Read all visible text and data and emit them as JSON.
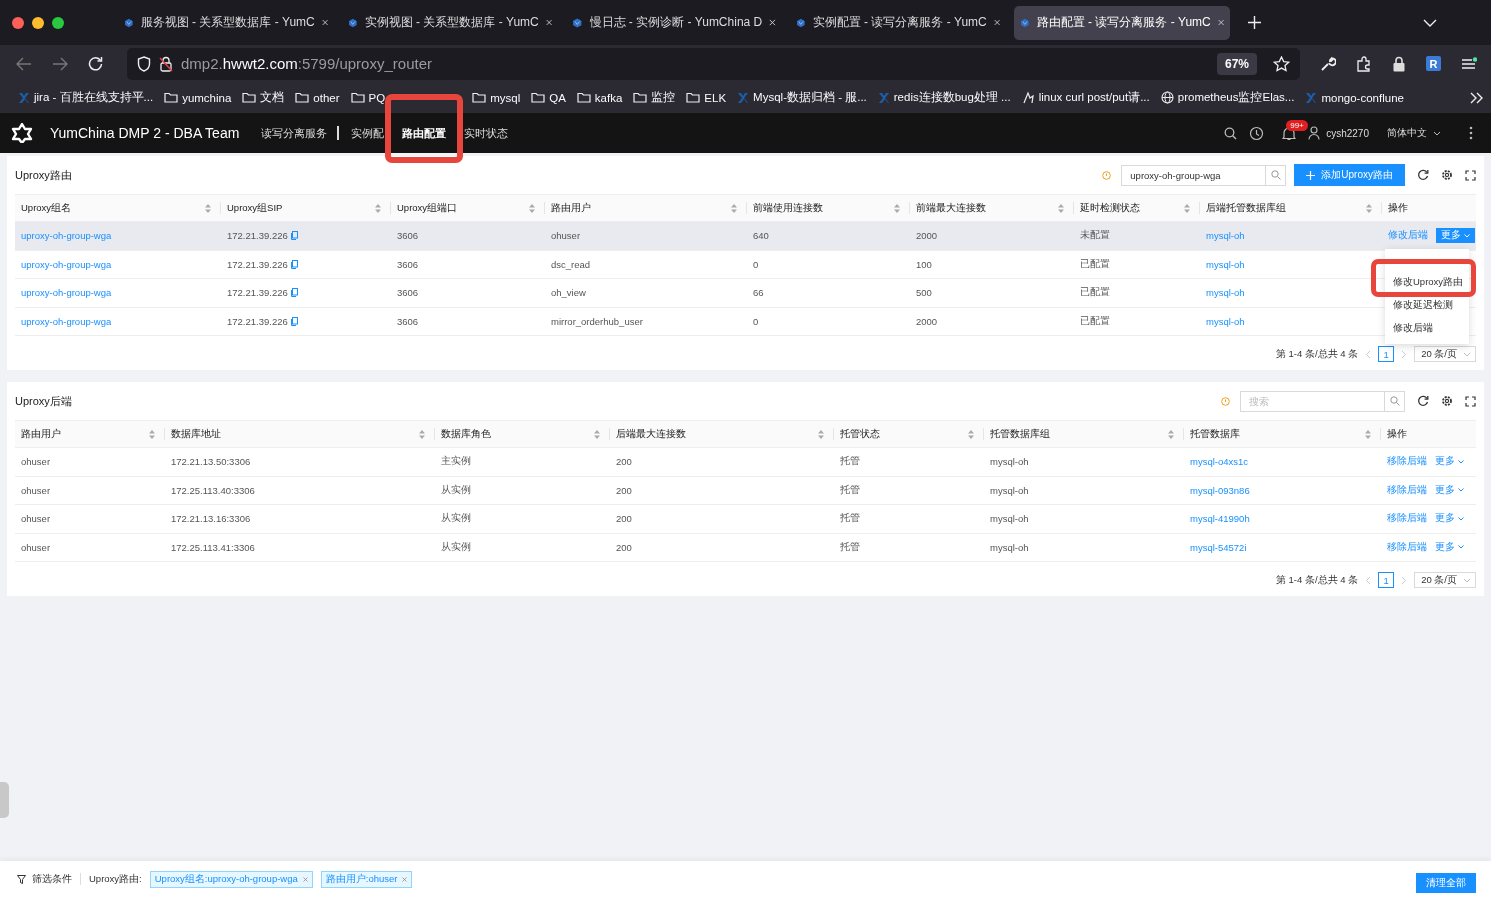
{
  "browser": {
    "tabs": [
      {
        "title": "服务视图 - 关系型数据库 - YumC",
        "selected": false
      },
      {
        "title": "实例视图 - 关系型数据库 - YumC",
        "selected": false
      },
      {
        "title": "慢日志 - 实例诊断 - YumChina D",
        "selected": false
      },
      {
        "title": "实例配置 - 读写分离服务 - YumC",
        "selected": false
      },
      {
        "title": "路由配置 - 读写分离服务 - YumC",
        "selected": true
      }
    ],
    "url": "dmp2.**hwwt2.com**:5799/uproxy_router",
    "zoom": "67%",
    "extension_label": "R"
  },
  "bookmarks": [
    {
      "kind": "app",
      "label": "jira - 百胜在线支持平..."
    },
    {
      "kind": "folder",
      "label": "yumchina"
    },
    {
      "kind": "folder",
      "label": "文档"
    },
    {
      "kind": "folder",
      "label": "other"
    },
    {
      "kind": "folder",
      "label": "PQ"
    },
    {
      "kind": "folder",
      "label": "mysql"
    },
    {
      "kind": "folder",
      "label": "QA"
    },
    {
      "kind": "folder",
      "label": "kafka"
    },
    {
      "kind": "folder",
      "label": "监控"
    },
    {
      "kind": "folder",
      "label": "ELK"
    },
    {
      "kind": "app",
      "label": "Mysql-数据归档 - 服..."
    },
    {
      "kind": "app",
      "label": "redis连接数bug处理 ..."
    },
    {
      "kind": "curl",
      "label": "linux curl post/put请..."
    },
    {
      "kind": "globe",
      "label": "prometheus监控Elas..."
    },
    {
      "kind": "app",
      "label": "mongo-conflune"
    }
  ],
  "app": {
    "title": "YumChina DMP 2 - DBA Team",
    "nav": [
      {
        "label": "读写分离服务",
        "selected": false
      },
      {
        "label": "实例配",
        "selected": false
      },
      {
        "label": "路由配置",
        "selected": true
      },
      {
        "label": "实时状态",
        "selected": false
      }
    ],
    "notification_badge": "99+",
    "user": "cysh2270",
    "language": "简体中文"
  },
  "router_panel": {
    "title": "Uproxy路由",
    "search_value": "uproxy-oh-group-wga",
    "add_button": "添加Uproxy路由",
    "columns": [
      "Uproxy组名",
      "Uproxy组SIP",
      "Uproxy组端口",
      "路由用户",
      "前端使用连接数",
      "前端最大连接数",
      "延时检测状态",
      "后端托管数据库组",
      "操作"
    ],
    "rows": [
      {
        "selected": true,
        "cells": [
          "uproxy-oh-group-wga",
          "172.21.39.226",
          "3606",
          "ohuser",
          "640",
          "2000",
          "未配置",
          "mysql-oh"
        ],
        "actions": [
          "修改后端",
          "更多"
        ]
      },
      {
        "selected": false,
        "cells": [
          "uproxy-oh-group-wga",
          "172.21.39.226",
          "3606",
          "dsc_read",
          "0",
          "100",
          "已配置",
          "mysql-oh"
        ]
      },
      {
        "selected": false,
        "cells": [
          "uproxy-oh-group-wga",
          "172.21.39.226",
          "3606",
          "oh_view",
          "66",
          "500",
          "已配置",
          "mysql-oh"
        ]
      },
      {
        "selected": false,
        "cells": [
          "uproxy-oh-group-wga",
          "172.21.39.226",
          "3606",
          "mirror_orderhub_user",
          "0",
          "2000",
          "已配置",
          "mysql-oh"
        ]
      }
    ],
    "dropdown": [
      "修改Uproxy路由",
      "修改延迟检测",
      "修改后端"
    ],
    "pagination": {
      "summary": "第 1-4 条/总共 4 条",
      "page": "1",
      "page_size": "20 条/页"
    }
  },
  "backend_panel": {
    "title": "Uproxy后端",
    "search_placeholder": "搜索",
    "columns": [
      "路由用户",
      "数据库地址",
      "数据库角色",
      "后端最大连接数",
      "托管状态",
      "托管数据库组",
      "托管数据库",
      "操作"
    ],
    "rows": [
      {
        "cells": [
          "ohuser",
          "172.21.13.50:3306",
          "主实例",
          "200",
          "托管",
          "mysql-oh",
          "mysql-o4xs1c"
        ],
        "actions": [
          "移除后端",
          "更多"
        ]
      },
      {
        "cells": [
          "ohuser",
          "172.25.113.40:3306",
          "从实例",
          "200",
          "托管",
          "mysql-oh",
          "mysql-093n86"
        ],
        "actions": [
          "移除后端",
          "更多"
        ]
      },
      {
        "cells": [
          "ohuser",
          "172.21.13.16:3306",
          "从实例",
          "200",
          "托管",
          "mysql-oh",
          "mysql-41990h"
        ],
        "actions": [
          "移除后端",
          "更多"
        ]
      },
      {
        "cells": [
          "ohuser",
          "172.25.113.41:3306",
          "从实例",
          "200",
          "托管",
          "mysql-oh",
          "mysql-54572i"
        ],
        "actions": [
          "移除后端",
          "更多"
        ]
      }
    ],
    "pagination": {
      "summary": "第 1-4 条/总共 4 条",
      "page": "1",
      "page_size": "20 条/页"
    }
  },
  "filter_bar": {
    "title": "筛选条件",
    "group_label": "Uproxy路由:",
    "tags": [
      "Uproxy组名:uproxy-oh-group-wga",
      "路由用户:ohuser"
    ],
    "clear_button": "清理全部"
  }
}
